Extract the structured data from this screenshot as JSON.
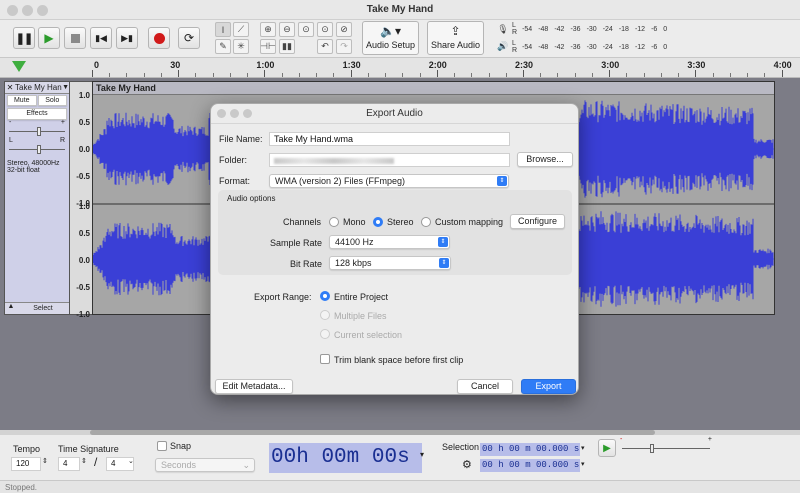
{
  "window": {
    "title": "Take My Hand"
  },
  "toolbar": {
    "audio_setup_label": "Audio Setup",
    "share_audio_label": "Share Audio",
    "meter_ticks": [
      "-54",
      "-48",
      "-42",
      "-36",
      "-30",
      "-24",
      "-18",
      "-12",
      "-6",
      "0"
    ],
    "record_color": "#d11a1a",
    "play_color": "#2c9c2c"
  },
  "ruler": {
    "ticks": [
      "0",
      "30",
      "1:00",
      "1:30",
      "2:00",
      "2:30",
      "3:00",
      "3:30",
      "4:00"
    ]
  },
  "track": {
    "name": "Take My Han",
    "clip_name": "Take My Hand",
    "mute_label": "Mute",
    "solo_label": "Solo",
    "effects_label": "Effects",
    "info_line1": "Stereo, 48000Hz",
    "info_line2": "32-bit float",
    "select_label": "Select",
    "gain_minus": "-",
    "gain_plus": "+",
    "pan_left": "L",
    "pan_right": "R",
    "y_ticks": [
      "1.0",
      "0.5",
      "0.0",
      "-0.5",
      "-1.0"
    ],
    "wave_color": "#3a3fd6"
  },
  "dialog": {
    "title": "Export Audio",
    "file_name_label": "File Name:",
    "file_name_value": "Take My Hand.wma",
    "folder_label": "Folder:",
    "browse_label": "Browse...",
    "format_label": "Format:",
    "format_value": "WMA (version 2) Files (FFmpeg)",
    "audio_options_label": "Audio options",
    "channels_label": "Channels",
    "channel_mono": "Mono",
    "channel_stereo": "Stereo",
    "channel_custom": "Custom mapping",
    "configure_label": "Configure",
    "sample_rate_label": "Sample Rate",
    "sample_rate_value": "44100 Hz",
    "bit_rate_label": "Bit Rate",
    "bit_rate_value": "128 kbps",
    "export_range_label": "Export Range:",
    "range_entire": "Entire Project",
    "range_multiple": "Multiple Files",
    "range_current": "Current selection",
    "trim_label": "Trim blank space before first clip",
    "edit_metadata_label": "Edit Metadata...",
    "cancel_label": "Cancel",
    "export_label": "Export",
    "accent_color": "#2f7cf6"
  },
  "bottom": {
    "tempo_label": "Tempo",
    "tempo_value": "120",
    "time_sig_label": "Time Signature",
    "time_sig_num": "4",
    "time_sig_slash": "/",
    "time_sig_den": "4",
    "snap_label": "Snap",
    "snap_unit": "Seconds",
    "time_h": "00",
    "time_m": "00",
    "time_s": "00",
    "unit_h": "h",
    "unit_m": "m",
    "unit_s": "s",
    "selection_label": "Selection",
    "sel_start": "00 h 00 m 00.000 s",
    "sel_end": "00 h 00 m 00.000 s",
    "speed_minus": "-",
    "speed_plus": "+"
  },
  "status": {
    "text": "Stopped."
  }
}
